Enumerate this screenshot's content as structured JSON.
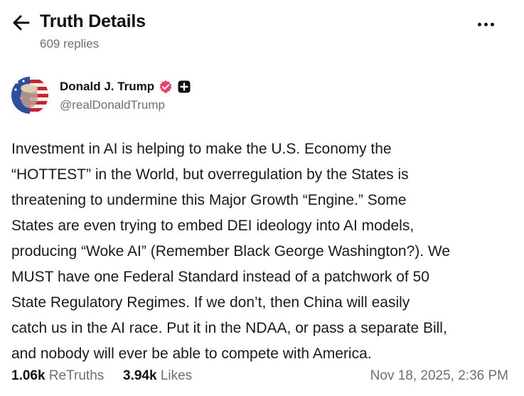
{
  "header": {
    "title": "Truth Details",
    "replies": "609 replies"
  },
  "author": {
    "name": "Donald J. Trump",
    "handle": "@realDonaldTrump",
    "badge_color": "#e8426a"
  },
  "post": {
    "lines": [
      "Investment in AI is helping to make the U.S. Economy the",
      "“HOTTEST” in the World, but overregulation by the States is",
      "threatening to undermine this Major Growth “Engine.” Some",
      "States are even trying to embed DEI ideology into AI models,",
      "producing “Woke AI” (Remember Black George Washington?). We",
      "MUST have one Federal Standard instead of a patchwork of 50",
      "State Regulatory Regimes. If we don’t, then China will easily",
      "catch us in the AI race. Put it in the NDAA, or pass a separate Bill,",
      "and nobody will ever be able to compete with America."
    ]
  },
  "stats": {
    "retruths_count": "1.06k",
    "retruths_label": "ReTruths",
    "likes_count": "3.94k",
    "likes_label": "Likes"
  },
  "timestamp": "Nov 18, 2025, 2:36 PM",
  "icons": {
    "back": "arrow-left-icon",
    "more": "more-horizontal-icon",
    "verified": "verified-badge-icon",
    "plus": "plus-badge-icon"
  }
}
